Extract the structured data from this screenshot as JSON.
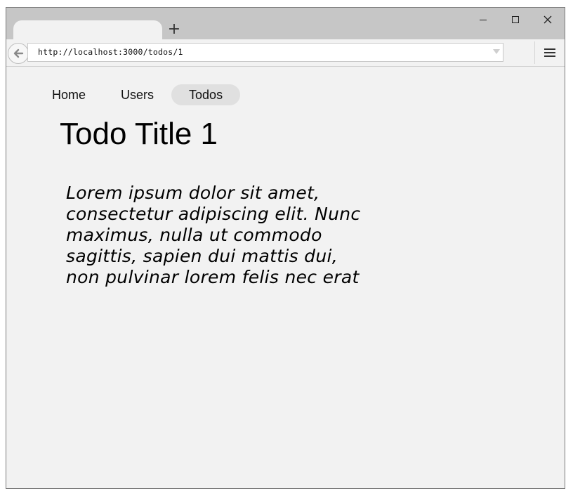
{
  "browser": {
    "new_tab_label": "+",
    "address": "http://localhost:3000/todos/1",
    "icons": {
      "back": "back-arrow-icon",
      "menu": "hamburger-menu-icon",
      "dropdown": "chevron-down-icon",
      "minimize": "minimize-icon",
      "maximize": "maximize-icon",
      "close": "close-icon"
    }
  },
  "nav": {
    "items": [
      {
        "label": "Home",
        "active": false
      },
      {
        "label": "Users",
        "active": false
      },
      {
        "label": "Todos",
        "active": true
      }
    ]
  },
  "todo": {
    "title": "Todo Title 1",
    "body": "Lorem ipsum dolor sit amet, consectetur adipiscing elit. Nunc maximus, nulla ut commodo sagittis, sapien dui mattis dui, non pulvinar lorem felis nec erat"
  },
  "colors": {
    "tabstrip": "#c6c6c6",
    "page_background": "#f2f2f2",
    "active_nav_pill": "#e0e0e0"
  }
}
